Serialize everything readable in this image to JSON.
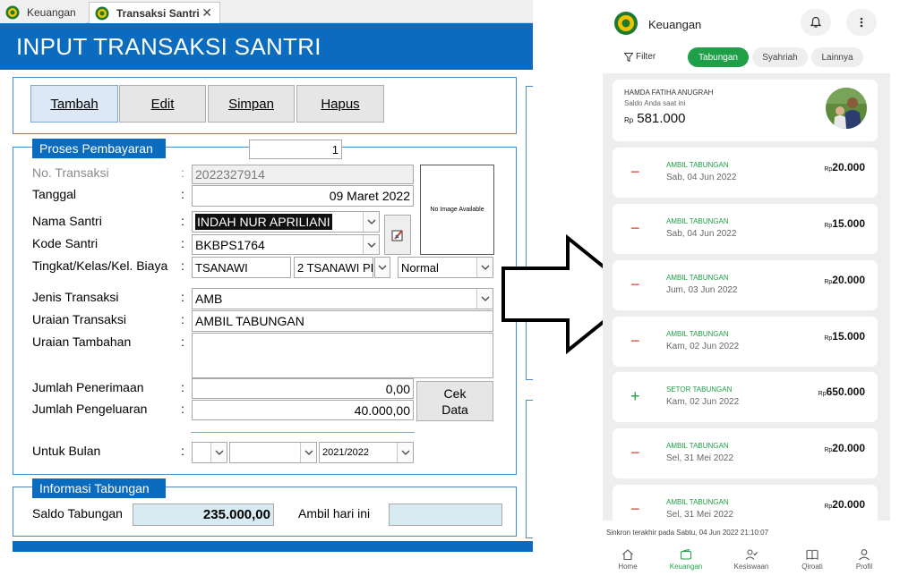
{
  "desktop": {
    "tabs": [
      {
        "label": "Keuangan",
        "icon": "app-logo-icon"
      },
      {
        "label": "Transaksi Santri",
        "icon": "app-logo-icon",
        "close": "✕"
      }
    ],
    "header_title": "INPUT TRANSAKSI SANTRI",
    "buttons": {
      "tambah": "Tambah",
      "edit": "Edit",
      "simpan": "Simpan",
      "hapus": "Hapus"
    },
    "proses": {
      "section_title": "Proses Pembayaran",
      "counter": "1",
      "no_transaksi_label": "No. Transaksi",
      "no_transaksi_value": "2022327914",
      "tanggal_label": "Tanggal",
      "tanggal_value": "09 Maret 2022",
      "nama_label": "Nama Santri",
      "nama_value": "INDAH NUR APRILIANI",
      "kode_label": "Kode Santri",
      "kode_value": "BKBPS1764",
      "tingkat_label": "Tingkat/Kelas/Kel. Biaya",
      "tingkat_value": "TSANAWI",
      "kelas_value": "2 TSANAWI PI",
      "kel_biaya_value": "Normal",
      "jenis_label": "Jenis Transaksi",
      "jenis_value": "AMB",
      "uraian_label": "Uraian Transaksi",
      "uraian_value": "AMBIL TABUNGAN",
      "uraian_tambahan_label": "Uraian Tambahan",
      "uraian_tambahan_value": "",
      "penerimaan_label": "Jumlah Penerimaan",
      "penerimaan_value": "0,00",
      "pengeluaran_label": "Jumlah Pengeluaran",
      "pengeluaran_value": "40.000,00",
      "cek_data_label": "Cek Data",
      "untuk_bulan_label": "Untuk Bulan",
      "tahun_value": "2021/2022",
      "no_image_text": "No Image Available",
      "colon": ":"
    },
    "tabungan": {
      "section_title": "Informasi Tabungan",
      "saldo_label": "Saldo Tabungan",
      "saldo_value": "235.000,00",
      "ambil_label": "Ambil hari ini",
      "ambil_value": ""
    }
  },
  "mobile": {
    "title": "Keuangan",
    "filter_label": "Filter",
    "chips": [
      "Tabungan",
      "Syahriah",
      "Lainnya"
    ],
    "balance": {
      "name": "HAMDA FATIHA ANUGRAH",
      "subtitle": "Saldo Anda saat ini",
      "currency": "Rp",
      "amount": "581.000"
    },
    "transactions": [
      {
        "sign": "−",
        "type": "AMBIL TABUNGAN",
        "date": "Sab, 04 Jun 2022",
        "currency": "Rp",
        "amount": "20.000"
      },
      {
        "sign": "−",
        "type": "AMBIL TABUNGAN",
        "date": "Sab, 04 Jun 2022",
        "currency": "Rp",
        "amount": "15.000"
      },
      {
        "sign": "−",
        "type": "AMBIL TABUNGAN",
        "date": "Jum, 03 Jun 2022",
        "currency": "Rp",
        "amount": "20.000"
      },
      {
        "sign": "−",
        "type": "AMBIL TABUNGAN",
        "date": "Kam, 02 Jun 2022",
        "currency": "Rp",
        "amount": "15.000"
      },
      {
        "sign": "+",
        "type": "SETOR TABUNGAN",
        "date": "Kam, 02 Jun 2022",
        "currency": "Rp",
        "amount": "650.000"
      },
      {
        "sign": "−",
        "type": "AMBIL TABUNGAN",
        "date": "Sel, 31 Mei 2022",
        "currency": "Rp",
        "amount": "20.000"
      },
      {
        "sign": "−",
        "type": "AMBIL TABUNGAN",
        "date": "Sel, 31 Mei 2022",
        "currency": "Rp",
        "amount": "20.000"
      }
    ],
    "sync_text": "Sinkron terakhir pada Sabtu, 04 Jun 2022 21:10:07",
    "nav": [
      {
        "label": "Home",
        "icon": "home-icon"
      },
      {
        "label": "Keuangan",
        "icon": "wallet-icon"
      },
      {
        "label": "Kesiswaan",
        "icon": "person-check-icon"
      },
      {
        "label": "Qiroati",
        "icon": "book-icon"
      },
      {
        "label": "Profil",
        "icon": "profile-icon"
      }
    ],
    "colors": {
      "accent": "#1f9f48",
      "debit": "#d9443b"
    }
  }
}
